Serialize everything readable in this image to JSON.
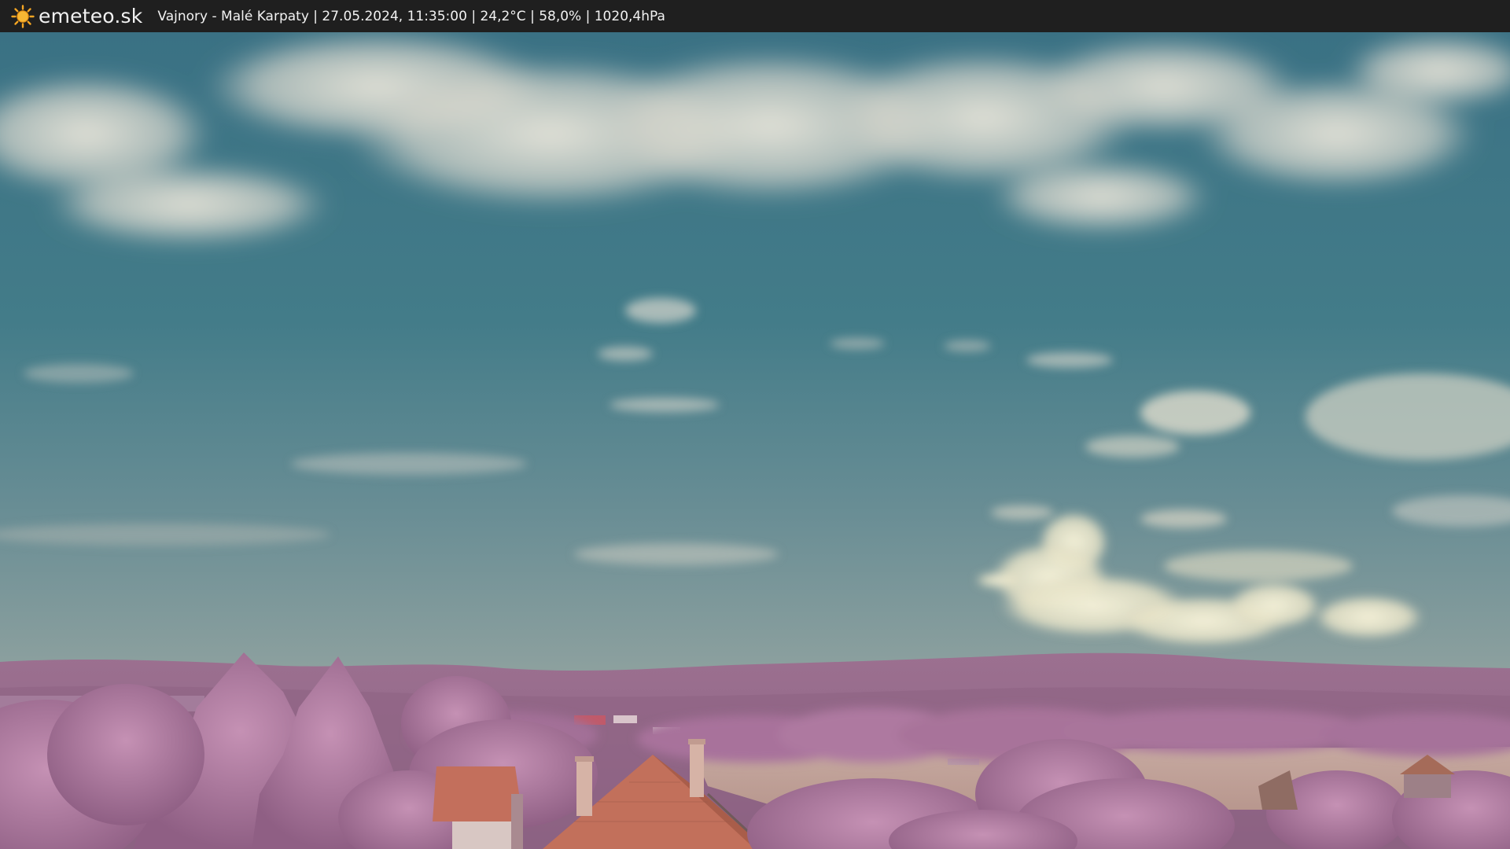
{
  "header": {
    "logo_icon": "sun-icon",
    "brand": "emeteo.sk",
    "caption": "Vajnory - Malé Karpaty | 27.05.2024, 11:35:00 | 24,2°C | 58,0% | 1020,4hPa"
  },
  "colors": {
    "bar_background": "#1f1f1f",
    "sun": "#f5a623",
    "sky_top": "#3f7587",
    "sky_horizon": "#7e999d",
    "hills": "#9a6f8f",
    "foliage": "#b07a9e",
    "field": "#c9a99e",
    "roof": "#c0705a"
  }
}
